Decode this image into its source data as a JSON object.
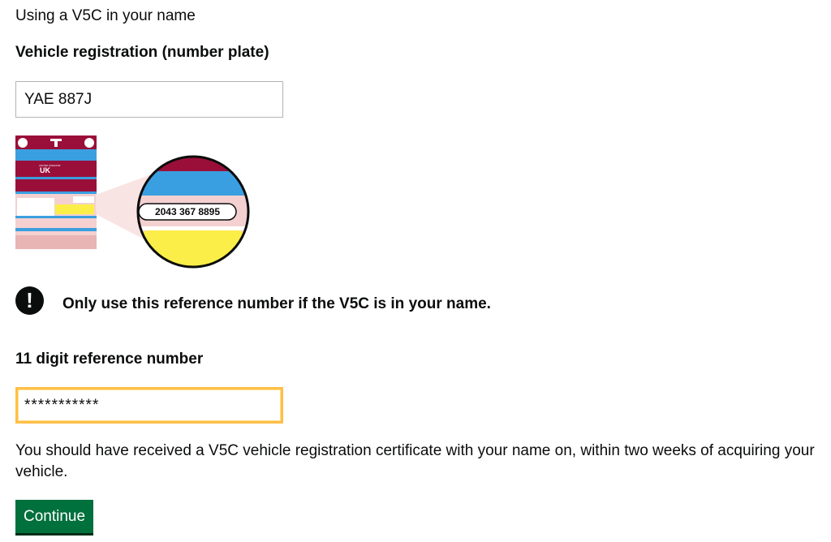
{
  "intro_text": "Using a V5C in your name",
  "registration": {
    "label": "Vehicle registration (number plate)",
    "value": "YAE 887J"
  },
  "illustration": {
    "reference_example": "2043 367 8895",
    "logo_text": "UK",
    "logo_small_text": "UNITED KINGDOM"
  },
  "warning": {
    "icon": "!",
    "text": "Only use this reference number if the V5C is in your name."
  },
  "reference": {
    "label": "11 digit reference number",
    "value": "***********"
  },
  "hint": "You should have received a V5C vehicle registration certificate with your name on, within two weeks of acquiring your vehicle.",
  "continue_label": "Continue",
  "colors": {
    "primary_button": "#00703c",
    "focus": "#ffbf47",
    "v5c_red": "#9a0f3a",
    "v5c_blue": "#3a9fe0",
    "v5c_pink": "#f4d0d0",
    "v5c_yellow": "#fcee48"
  }
}
